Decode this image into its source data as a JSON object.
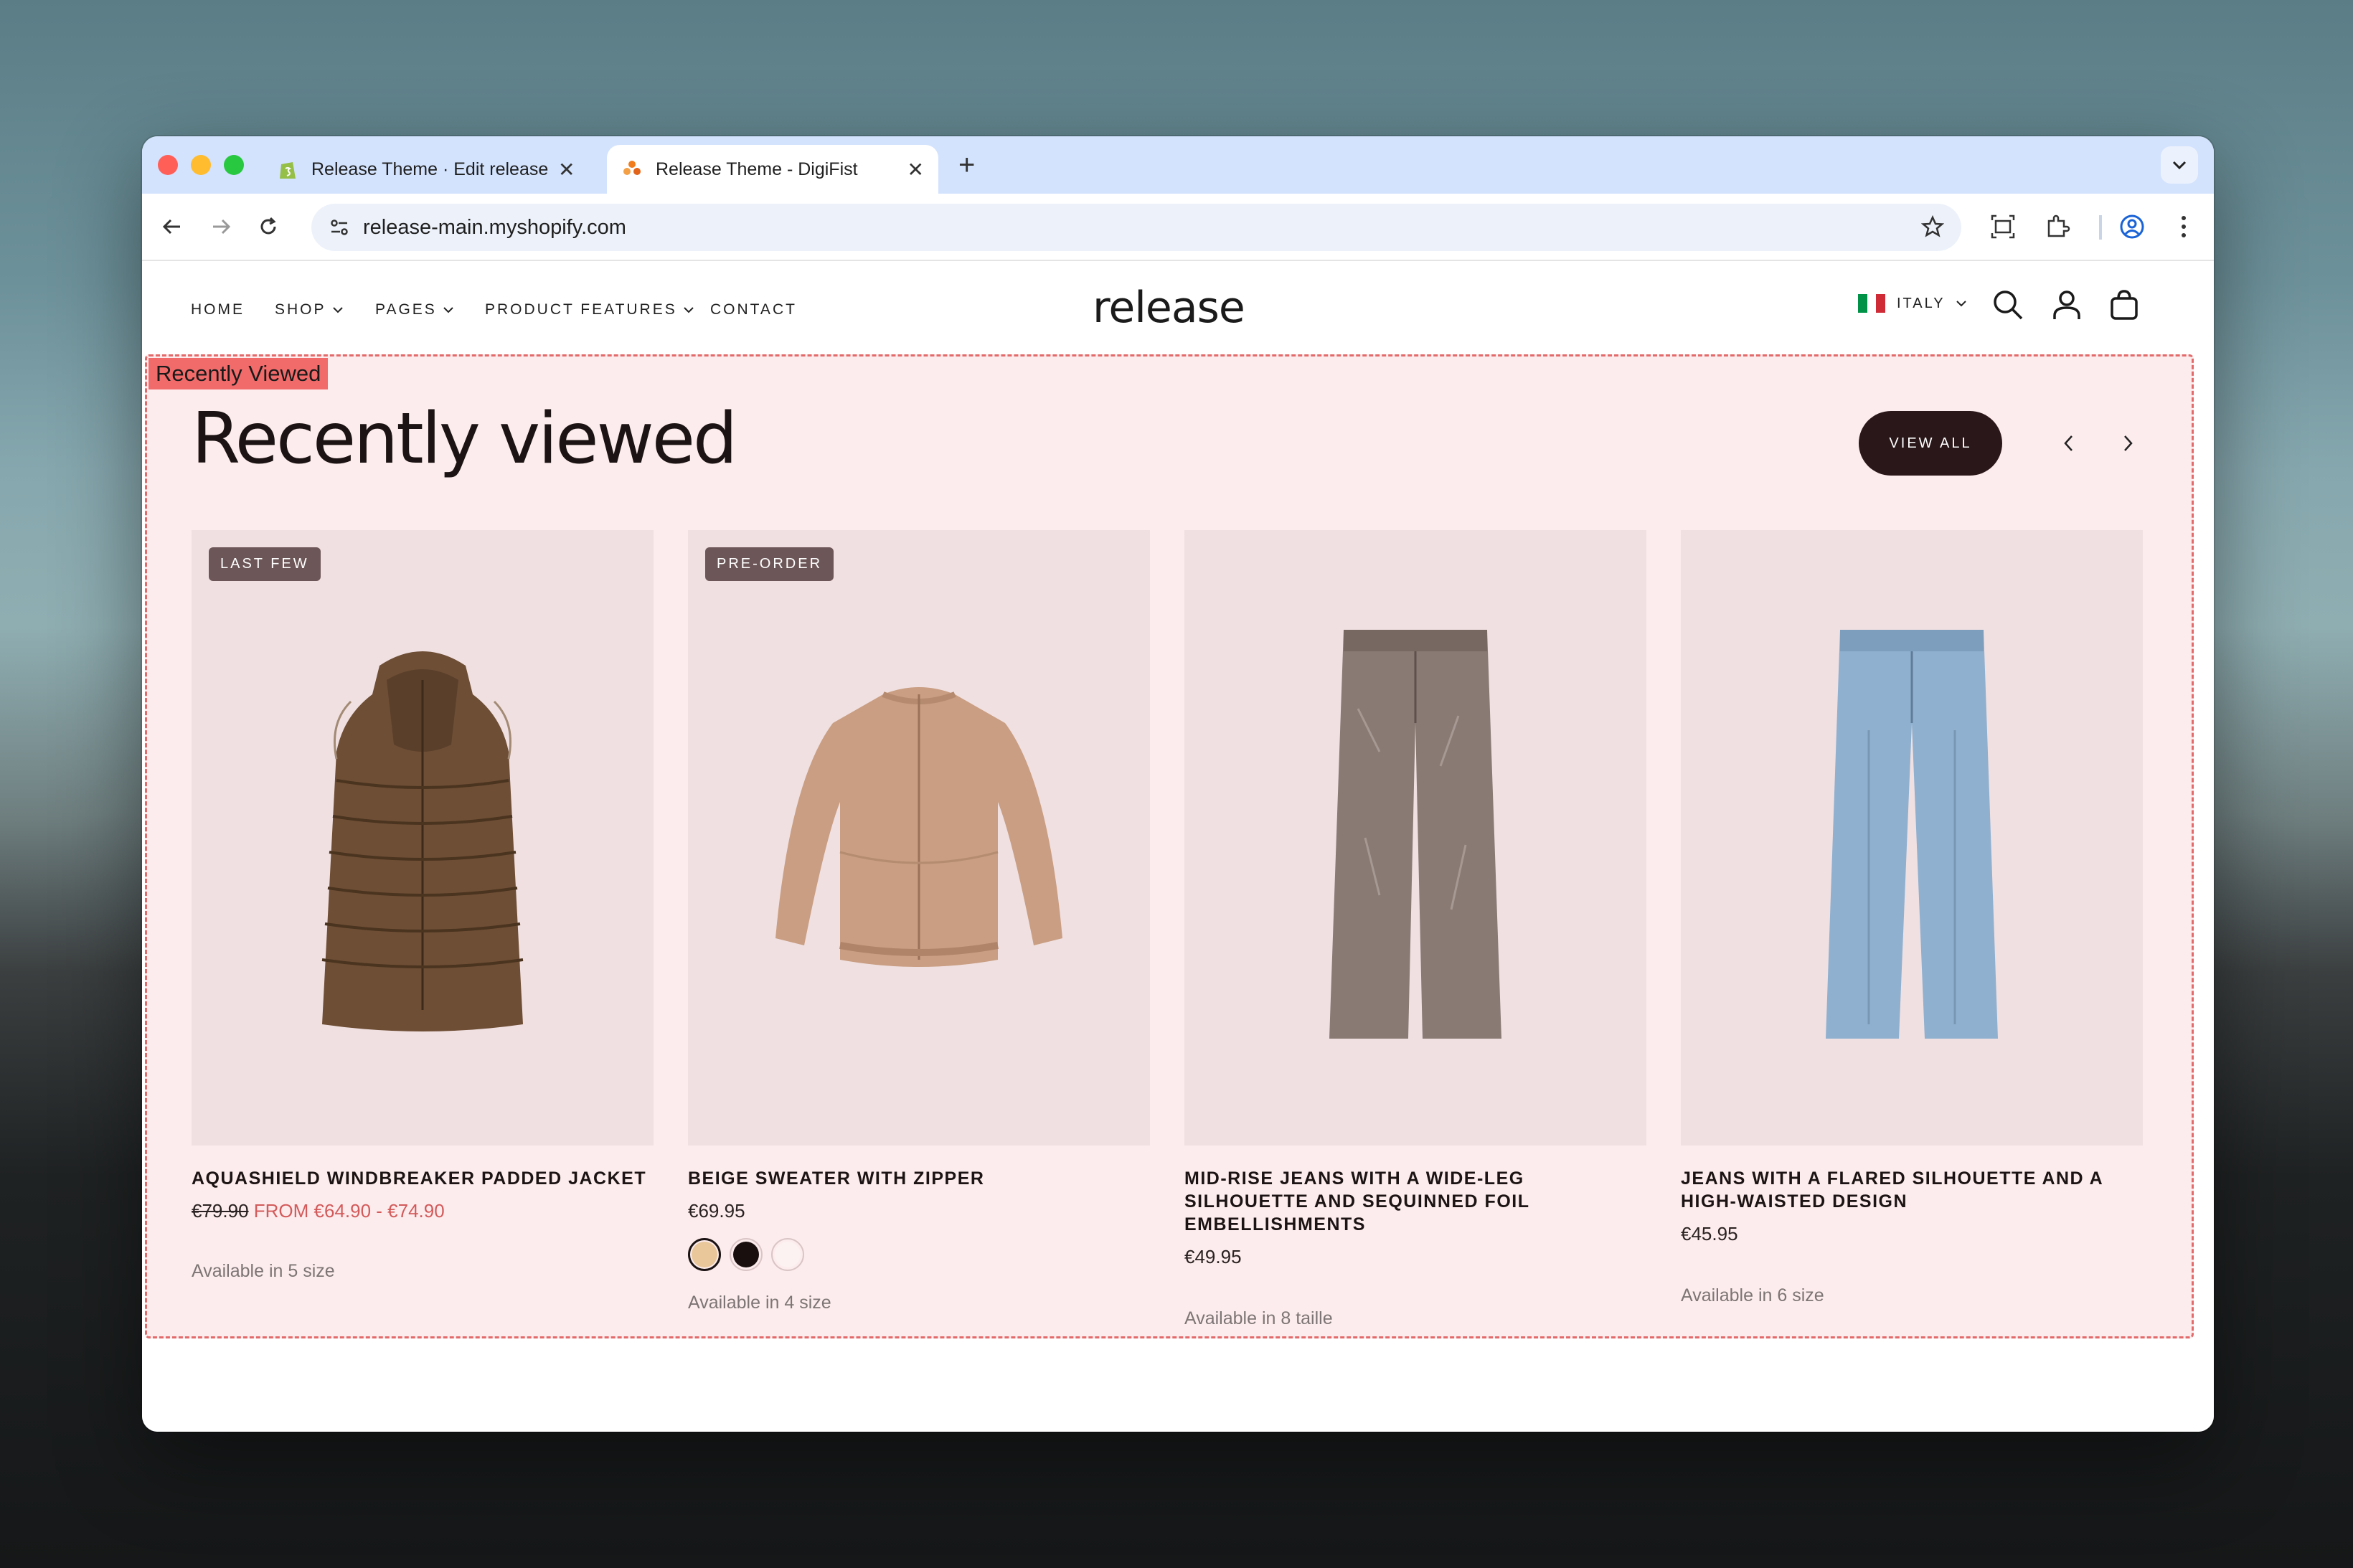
{
  "browser": {
    "tabs": [
      {
        "title": "Release Theme · Edit release",
        "active": false
      },
      {
        "title": "Release Theme - DigiFist",
        "active": true
      }
    ],
    "url": "release-main.myshopify.com"
  },
  "header": {
    "nav": [
      {
        "label": "HOME",
        "has_dropdown": false
      },
      {
        "label": "SHOP",
        "has_dropdown": true
      },
      {
        "label": "PAGES",
        "has_dropdown": true
      },
      {
        "label": "PRODUCT FEATURES",
        "has_dropdown": true
      },
      {
        "label": "CONTACT",
        "has_dropdown": false
      }
    ],
    "logo": "release",
    "country": "ITALY"
  },
  "section": {
    "tag": "Recently Viewed",
    "title": "Recently viewed",
    "view_all": "VIEW ALL"
  },
  "products": [
    {
      "badge": "LAST FEW",
      "name": "AQUASHIELD WINDBREAKER PADDED JACKET",
      "price_old": "€79.90",
      "price_sale": "FROM €64.90 - €74.90",
      "availability": "Available in 5 size"
    },
    {
      "badge": "PRE-ORDER",
      "name": "BEIGE SWEATER WITH ZIPPER",
      "price": "€69.95",
      "swatches": [
        "#e9c79b",
        "#1a0f0f",
        "#fbf2f1"
      ],
      "availability": "Available in 4 size"
    },
    {
      "name": "MID-RISE JEANS WITH A WIDE-LEG SILHOUETTE AND SEQUINNED FOIL EMBELLISHMENTS",
      "price": "€49.95",
      "availability": "Available in 8 taille"
    },
    {
      "name": "JEANS WITH A FLARED SILHOUETTE AND A HIGH-WAISTED DESIGN",
      "price": "€45.95",
      "availability": "Available in 6 size"
    }
  ]
}
